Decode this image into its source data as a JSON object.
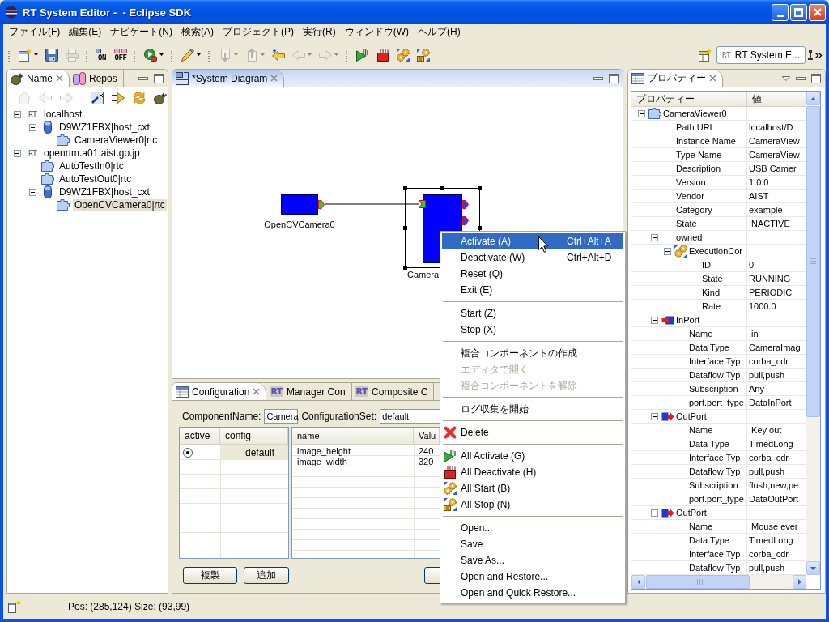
{
  "window": {
    "title": "RT System Editor -  - Eclipse SDK"
  },
  "menu_bar": [
    "ファイル(F)",
    "編集(E)",
    "ナビゲート(N)",
    "検索(A)",
    "プロジェクト(P)",
    "実行(R)",
    "ウィンドウ(W)",
    "ヘルプ(H)"
  ],
  "toolbar": {
    "groups": [
      {
        "items": [
          {
            "kind": "new",
            "dropdown": true,
            "disabled": false
          },
          {
            "kind": "save",
            "dropdown": false,
            "disabled": false
          },
          {
            "kind": "print",
            "dropdown": false,
            "disabled": true
          }
        ]
      },
      {
        "items": [
          {
            "kind": "online",
            "text": "ON",
            "dropdown": false,
            "disabled": false
          },
          {
            "kind": "offline",
            "text": "OFF",
            "dropdown": false,
            "disabled": false
          }
        ]
      },
      {
        "items": [
          {
            "kind": "run",
            "dropdown": true,
            "disabled": false
          }
        ]
      },
      {
        "items": [
          {
            "kind": "tool",
            "dropdown": true,
            "disabled": false
          }
        ]
      },
      {
        "items": [
          {
            "kind": "next",
            "dropdown": true,
            "disabled": true
          },
          {
            "kind": "previous",
            "dropdown": true,
            "disabled": true
          },
          {
            "kind": "lastedit",
            "dropdown": false,
            "disabled": false
          },
          {
            "kind": "back",
            "dropdown": true,
            "disabled": true
          },
          {
            "kind": "forward",
            "dropdown": true,
            "disabled": true
          }
        ]
      },
      {
        "items": [
          {
            "kind": "activate",
            "dropdown": false,
            "disabled": false
          },
          {
            "kind": "deactivate",
            "dropdown": false,
            "disabled": false
          },
          {
            "kind": "start",
            "dropdown": false,
            "disabled": false
          },
          {
            "kind": "stop",
            "dropdown": false,
            "disabled": false
          }
        ]
      }
    ],
    "perspective": {
      "badge": "RT",
      "label": "RT System E..."
    }
  },
  "navigator": {
    "tabs": [
      {
        "kind": "nameservice",
        "label": "Name",
        "selected": true
      },
      {
        "kind": "repository",
        "label": "Repos",
        "selected": false
      }
    ],
    "toolbar": [
      {
        "kind": "home",
        "disabled": true
      },
      {
        "kind": "back",
        "disabled": true
      },
      {
        "kind": "forward",
        "disabled": true
      },
      {
        "kind": "filter",
        "disabled": false
      },
      {
        "kind": "connect",
        "disabled": false
      },
      {
        "kind": "refresh",
        "disabled": false
      },
      {
        "kind": "plug",
        "disabled": false
      }
    ],
    "tree": [
      {
        "kind": "host",
        "badge": "RT",
        "label": "localhost",
        "expanded": true,
        "selected": false,
        "children": [
          {
            "kind": "context",
            "label": "D9WZ1FBX|host_cxt",
            "expanded": true,
            "selected": false,
            "children": [
              {
                "kind": "component",
                "label": "CameraViewer0|rtc",
                "selected": false
              }
            ]
          }
        ]
      },
      {
        "kind": "host",
        "badge": "RT",
        "label": "openrtm.a01.aist.go.jp",
        "expanded": true,
        "selected": false,
        "children": [
          {
            "kind": "component",
            "label": "AutoTestIn0|rtc",
            "selected": false
          },
          {
            "kind": "component",
            "label": "AutoTestOut0|rtc",
            "selected": false
          },
          {
            "kind": "context",
            "label": "D9WZ1FBX|host_cxt",
            "expanded": true,
            "selected": false,
            "children": [
              {
                "kind": "component",
                "label": "OpenCVCamera0|rtc",
                "selected": true
              }
            ]
          }
        ]
      }
    ]
  },
  "editor": {
    "tabs": [
      {
        "kind": "diagram",
        "label": "*System Diagram",
        "selected": true
      }
    ],
    "components": [
      {
        "name": "OpenCVCamera0",
        "selected": false,
        "ports": [
          {
            "kind": "out",
            "connected": true
          }
        ]
      },
      {
        "name": "Camera",
        "selected": true,
        "ports": [
          {
            "kind": "in",
            "connected": true
          },
          {
            "kind": "out",
            "connected": false
          },
          {
            "kind": "out",
            "connected": false
          }
        ]
      }
    ]
  },
  "bottom_panel": {
    "tabs": [
      {
        "kind": "configuration",
        "label": "Configuration",
        "selected": true
      },
      {
        "kind": "manager",
        "badge": "RT",
        "label": "Manager Con",
        "selected": false
      },
      {
        "kind": "composite",
        "badge": "RT",
        "label": "Composite C",
        "selected": false
      }
    ],
    "component_name": {
      "label": "ComponentName:",
      "value": "Camera"
    },
    "configuration_set": {
      "label": "ConfigurationSet:",
      "value": "default"
    },
    "sets_table": {
      "columns": [
        "active",
        "config"
      ],
      "rows": [
        {
          "active": true,
          "config": "default",
          "selected": true
        }
      ]
    },
    "params_table": {
      "columns": [
        "name",
        "Valu"
      ],
      "rows": [
        {
          "name": "image_height",
          "value": "240"
        },
        {
          "name": "image_width",
          "value": "320"
        }
      ]
    },
    "buttons": [
      "複製",
      "追加"
    ]
  },
  "properties": {
    "tabs": [
      {
        "kind": "properties",
        "label": "プロパティー",
        "selected": true
      }
    ],
    "columns": [
      "プロパティー",
      "値"
    ],
    "rows": [
      {
        "kind": "component",
        "name": "CameraViewer0",
        "expanded": true,
        "children": [
          {
            "name": "Path URI",
            "value": "localhost/D"
          },
          {
            "name": "Instance Name",
            "value": "CameraView"
          },
          {
            "name": "Type Name",
            "value": "CameraView"
          },
          {
            "name": "Description",
            "value": "USB Camer"
          },
          {
            "name": "Version",
            "value": "1.0.0"
          },
          {
            "name": "Vendor",
            "value": "AIST"
          },
          {
            "name": "Category",
            "value": "example"
          },
          {
            "name": "State",
            "value": "INACTIVE"
          },
          {
            "name": "owned",
            "expanded": true,
            "children": [
              {
                "kind": "execution",
                "name": "ExecutionCor",
                "expanded": true,
                "children": [
                  {
                    "name": "ID",
                    "value": "0"
                  },
                  {
                    "name": "State",
                    "value": "RUNNING"
                  },
                  {
                    "name": "Kind",
                    "value": "PERIODIC"
                  },
                  {
                    "name": "Rate",
                    "value": "1000.0"
                  }
                ]
              }
            ]
          },
          {
            "kind": "inport",
            "name": "InPort",
            "expanded": true,
            "children": [
              {
                "name": "Name",
                "value": ".in"
              },
              {
                "name": "Data Type",
                "value": "CameraImag"
              },
              {
                "name": "Interface Typ",
                "value": "corba_cdr"
              },
              {
                "name": "Dataflow Typ",
                "value": "pull,push"
              },
              {
                "name": "Subscription",
                "value": "Any"
              },
              {
                "name": "port.port_type",
                "value": "DataInPort"
              }
            ]
          },
          {
            "kind": "outport",
            "name": "OutPort",
            "expanded": true,
            "children": [
              {
                "name": "Name",
                "value": ".Key out"
              },
              {
                "name": "Data Type",
                "value": "TimedLong"
              },
              {
                "name": "Interface Typ",
                "value": "corba_cdr"
              },
              {
                "name": "Dataflow Typ",
                "value": "pull,push"
              },
              {
                "name": "Subscription",
                "value": "flush,new,pe"
              },
              {
                "name": "port.port_type",
                "value": "DataOutPort"
              }
            ]
          },
          {
            "kind": "outport",
            "name": "OutPort",
            "expanded": true,
            "children": [
              {
                "name": "Name",
                "value": ".Mouse ever"
              },
              {
                "name": "Data Type",
                "value": "TimedLong"
              },
              {
                "name": "Interface Typ",
                "value": "corba_cdr"
              },
              {
                "name": "Dataflow Typ",
                "value": "pull,push"
              }
            ]
          }
        ]
      }
    ]
  },
  "context_menu": {
    "groups": [
      {
        "items": [
          {
            "label": "Activate (A)",
            "shortcut": "Ctrl+Alt+A",
            "selected": true,
            "disabled": false
          },
          {
            "label": "Deactivate (W)",
            "shortcut": "Ctrl+Alt+D",
            "selected": false,
            "disabled": false
          },
          {
            "label": "Reset (Q)",
            "selected": false,
            "disabled": false
          },
          {
            "label": "Exit (E)",
            "selected": false,
            "disabled": false
          }
        ]
      },
      {
        "items": [
          {
            "label": "Start (Z)",
            "selected": false,
            "disabled": false
          },
          {
            "label": "Stop (X)",
            "selected": false,
            "disabled": false
          }
        ]
      },
      {
        "items": [
          {
            "label": "複合コンポーネントの作成",
            "selected": false,
            "disabled": false
          },
          {
            "label": "エディタで開く",
            "selected": false,
            "disabled": true
          },
          {
            "label": "複合コンポーネントを解除",
            "selected": false,
            "disabled": true
          }
        ]
      },
      {
        "items": [
          {
            "label": "ログ収集を開始",
            "selected": false,
            "disabled": false
          }
        ]
      },
      {
        "items": [
          {
            "kind": "delete",
            "label": "Delete",
            "selected": false,
            "disabled": false
          }
        ]
      },
      {
        "items": [
          {
            "kind": "activate",
            "label": "All Activate (G)",
            "selected": false,
            "disabled": false
          },
          {
            "kind": "deactivate",
            "label": "All Deactivate (H)",
            "selected": false,
            "disabled": false
          },
          {
            "kind": "start",
            "label": "All Start (B)",
            "selected": false,
            "disabled": false
          },
          {
            "kind": "stop",
            "label": "All Stop (N)",
            "selected": false,
            "disabled": false
          }
        ]
      },
      {
        "items": [
          {
            "label": "Open...",
            "selected": false,
            "disabled": false
          },
          {
            "label": "Save",
            "selected": false,
            "disabled": false
          },
          {
            "label": "Save As...",
            "selected": false,
            "disabled": false
          },
          {
            "label": "Open and Restore...",
            "selected": false,
            "disabled": false
          },
          {
            "label": "Open and Quick Restore...",
            "selected": false,
            "disabled": false
          }
        ]
      }
    ]
  },
  "status_bar": {
    "text": "Pos: (285,124) Size: (93,99)"
  }
}
